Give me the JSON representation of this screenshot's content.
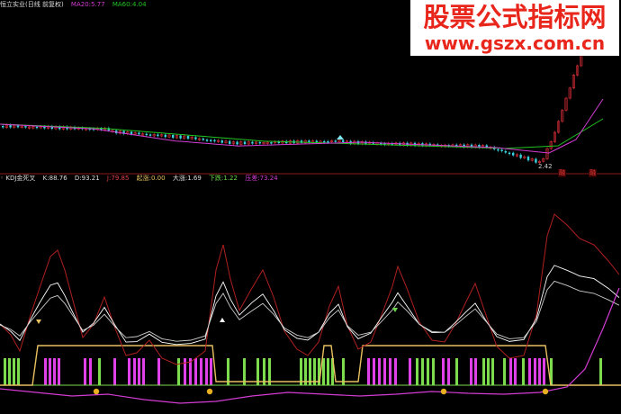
{
  "upper_panel": {
    "stock_name": "恒立实业(日线 前复权)",
    "indicators": [
      {
        "label": "MA20:",
        "value": "5.77",
        "color": "#d23cd2"
      },
      {
        "label": "MA60:",
        "value": "4.04",
        "color": "#22c322"
      }
    ],
    "low_price_label": "2.42",
    "badges": [
      {
        "text": "融",
        "color": "#ff4040",
        "bg": "#330000"
      },
      {
        "text": "融",
        "color": "#ff4040",
        "bg": "#330000"
      }
    ]
  },
  "lower_panel": {
    "indicator_name": "KDJ金死叉",
    "values": [
      {
        "label": "K:",
        "value": "88.76",
        "color": "#dddddd"
      },
      {
        "label": "D:",
        "value": "93.21",
        "color": "#dddddd"
      },
      {
        "label": "J:",
        "value": "79.85",
        "color": "#e0404a"
      }
    ],
    "signals": [
      {
        "label": "起涨:",
        "value": "0.00",
        "color": "#e8c060"
      },
      {
        "label": "大涨:",
        "value": "1.69",
        "color": "#dddddd"
      },
      {
        "label": "下跌:",
        "value": "1.22",
        "color": "#6ad84a"
      },
      {
        "label": "压差:",
        "value": "73.24",
        "color": "#d23cd2"
      }
    ]
  },
  "watermark": {
    "title": "股票公式指标网",
    "url": "www.gszx.com.cn",
    "color": "#e8261c"
  },
  "colors": {
    "background": "#000000",
    "separator": "#8a1a1a",
    "candle_up": "#e0303a",
    "candle_down": "#3ad4e0",
    "ma20": "#d23cd2",
    "ma60": "#22c322",
    "k_line": "#ffffff",
    "d_line": "#cccccc",
    "j_line": "#b02020",
    "bar_green": "#7ddc4e",
    "bar_magenta": "#e040e8",
    "step_line": "#e8c060",
    "bottom_line": "#d23cd2",
    "marker": "#e8b020"
  }
}
